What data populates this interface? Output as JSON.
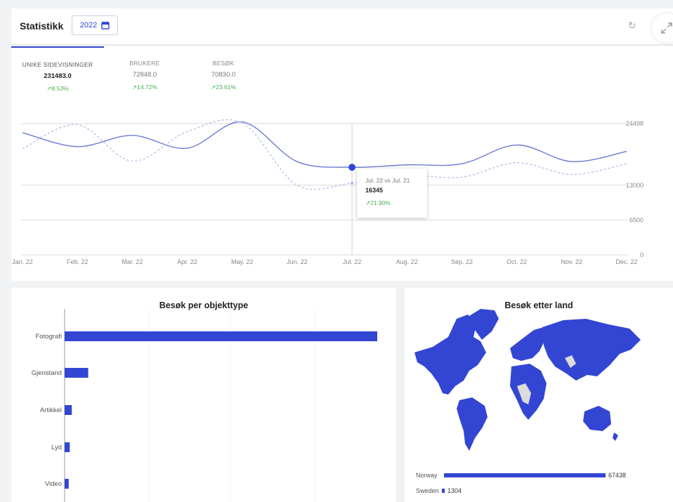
{
  "header": {
    "title": "Statistikk",
    "year": "2022"
  },
  "tabs": [
    {
      "label": "UNIKE SIDEVISNINGER",
      "value": "231483.0",
      "trend": "8.53%"
    },
    {
      "label": "BRUKERE",
      "value": "72848.0",
      "trend": "14.72%"
    },
    {
      "label": "BESØK",
      "value": "70830.0",
      "trend": "23.61%"
    }
  ],
  "tooltip": {
    "title": "Jul. 22 vs Jul. 21",
    "value": "16345",
    "trend": "21.90%"
  },
  "chart_data": [
    {
      "type": "line",
      "x": [
        "Jan. 22",
        "Feb. 22",
        "Mar. 22",
        "Apr. 22",
        "May. 22",
        "Jun. 22",
        "Jul. 22",
        "Aug. 22",
        "Sep. 22",
        "Oct. 22",
        "Nov. 22",
        "Dec. 22"
      ],
      "y_ticks": [
        0,
        6500,
        13000,
        24498
      ],
      "ylim": [
        0,
        24498
      ],
      "series": [
        {
          "style": "solid",
          "values": [
            22800,
            20200,
            22300,
            19900,
            24800,
            17400,
            16345,
            16800,
            17000,
            20500,
            17400,
            19300
          ]
        },
        {
          "style": "dashed",
          "values": [
            19800,
            24300,
            17500,
            23000,
            24600,
            13000,
            13400,
            14800,
            14500,
            17200,
            15000,
            17000
          ]
        }
      ],
      "grid": true,
      "highlight_index": 6
    },
    {
      "type": "bar",
      "title": "Besøk per objekttype",
      "categories": [
        "Fotografi",
        "Gjenstand",
        "Artikkel",
        "Lyd",
        "Video"
      ],
      "values": [
        61000,
        4600,
        1400,
        1000,
        800
      ],
      "xlim": [
        0,
        61000
      ],
      "orientation": "horizontal"
    },
    {
      "type": "bar",
      "title": "Besøk etter land",
      "categories": [
        "Norway",
        "Sweden"
      ],
      "values": [
        67438,
        1304
      ],
      "orientation": "horizontal"
    }
  ],
  "map": {
    "title": "Besøk etter land",
    "fill_color": "#3346d3",
    "empty_color": "#dcdcdc"
  },
  "colors": {
    "accent": "#3346d3",
    "positive": "#4caf50"
  }
}
